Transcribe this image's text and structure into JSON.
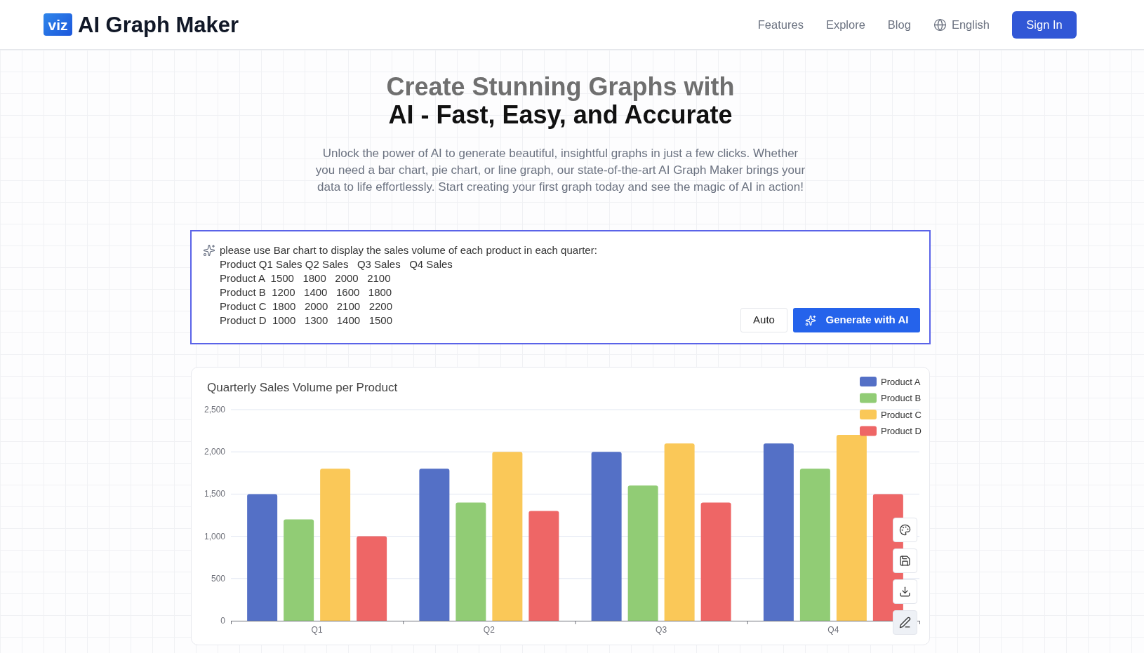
{
  "header": {
    "logo_mark": "viz",
    "title": "AI Graph Maker",
    "nav": [
      "Features",
      "Explore",
      "Blog"
    ],
    "language": "English",
    "sign_in": "Sign In"
  },
  "hero": {
    "title_lines": [
      "Create Stunning Graphs with",
      "AI - Fast, Easy, and Accurate"
    ],
    "description": "Unlock the power of AI to generate beautiful, insightful graphs in just a few clicks. Whether you need a bar chart, pie chart, or line graph, our state-of-the-art AI Graph Maker brings your data to life effortlessly. Start creating your first graph today and see the magic of AI in action!"
  },
  "prompt": {
    "value": "please use Bar chart to display the sales volume of each product in each quarter:\nProduct Q1 Sales Q2 Sales   Q3 Sales   Q4 Sales\nProduct A  1500   1800   2000   2100\nProduct B  1200   1400   1600   1800\nProduct C  1800   2000   2100   2200\nProduct D  1000   1300   1400   1500",
    "buttons": [
      {
        "kind": "plain",
        "label": "Auto"
      },
      {
        "kind": "primary",
        "label": "Generate with AI"
      }
    ]
  },
  "chart": {
    "tools": [
      {
        "kind": "palette",
        "selected": false
      },
      {
        "kind": "save",
        "selected": false
      },
      {
        "kind": "download",
        "selected": false
      },
      {
        "kind": "edit",
        "selected": true
      }
    ],
    "chart_data": {
      "type": "bar",
      "title": "Quarterly Sales Volume per Product",
      "grid": true,
      "legend": true,
      "categories": [
        "Q1",
        "Q2",
        "Q3",
        "Q4"
      ],
      "series": [
        {
          "name": "Product A",
          "color": "#5470c6",
          "values": [
            1500,
            1800,
            2000,
            2100
          ]
        },
        {
          "name": "Product B",
          "color": "#91cc75",
          "values": [
            1200,
            1400,
            1600,
            1800
          ]
        },
        {
          "name": "Product C",
          "color": "#fac858",
          "values": [
            1800,
            2000,
            2100,
            2200
          ]
        },
        {
          "name": "Product D",
          "color": "#ee6666",
          "values": [
            1000,
            1300,
            1400,
            1500
          ]
        }
      ],
      "ylim": [
        0,
        2500
      ],
      "yticks": [
        {
          "value": 0,
          "label": "0"
        },
        {
          "value": 500,
          "label": "500"
        },
        {
          "value": 1000,
          "label": "1,000"
        },
        {
          "value": 1500,
          "label": "1,500"
        },
        {
          "value": 2000,
          "label": "2,000"
        },
        {
          "value": 2500,
          "label": "2,500"
        }
      ]
    }
  }
}
